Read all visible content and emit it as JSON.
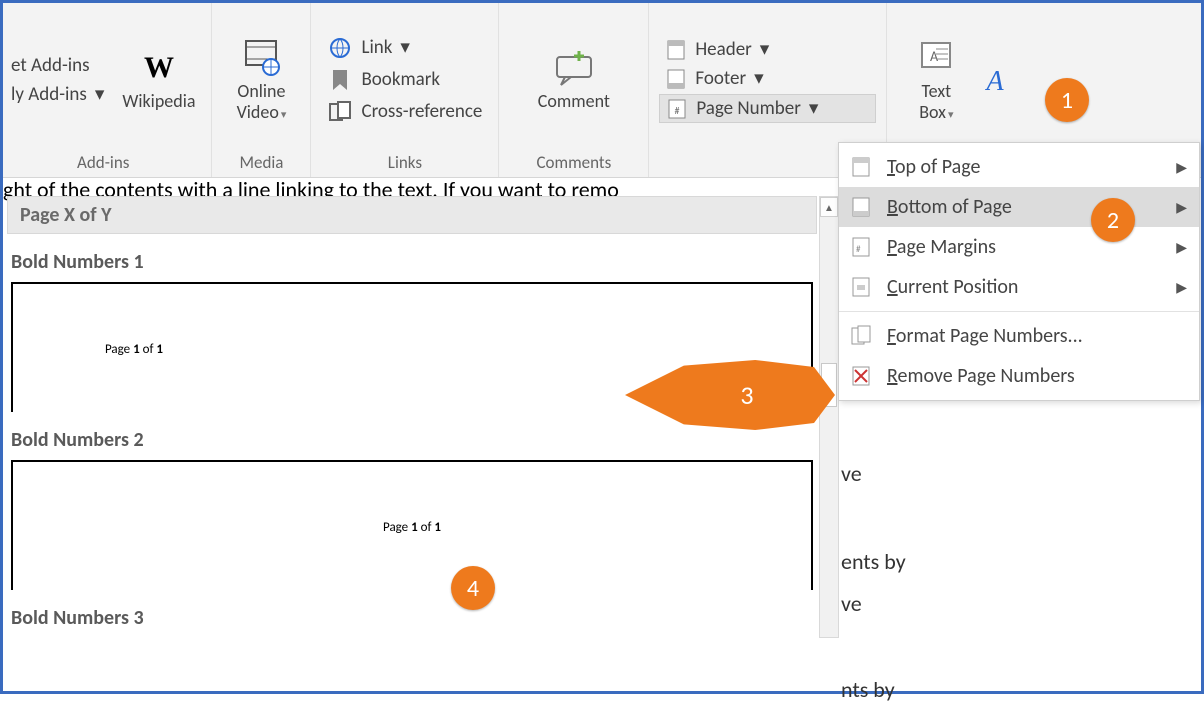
{
  "ribbon": {
    "addins": {
      "get": "et Add-ins",
      "my": "ly Add-ins",
      "wikipedia": "Wikipedia",
      "group": "Add-ins"
    },
    "media": {
      "online_video_l1": "Online",
      "online_video_l2": "Video",
      "group": "Media"
    },
    "links": {
      "link": "Link",
      "bookmark": "Bookmark",
      "crossref": "Cross-reference",
      "group": "Links"
    },
    "comments": {
      "comment": "Comment",
      "group": "Comments"
    },
    "headerfooter": {
      "header": "Header",
      "footer": "Footer",
      "page_number": "Page Number"
    },
    "text": {
      "textbox_l1": "Text",
      "textbox_l2": "Box"
    }
  },
  "cutline": "ght of the contents with a line linking to the text. If you want to remo",
  "gallery": {
    "header": "Page X of Y",
    "item1_title": "Bold Numbers 1",
    "item2_title": "Bold Numbers 2",
    "item3_title": "Bold Numbers 3",
    "sample_prefix": "Page ",
    "sample_bold1": "1",
    "sample_mid": " of ",
    "sample_bold2": "1"
  },
  "menu": {
    "top": "Top of Page",
    "bottom": "Bottom of Page",
    "margins": "Page Margins",
    "current": "Current Position",
    "format": "Format Page Numbers...",
    "remove": "Remove Page Numbers"
  },
  "behind": {
    "l1": "ve",
    "l2": "ents by",
    "l3": "ve",
    "l4": "nts by"
  },
  "badges": {
    "b1": "1",
    "b2": "2",
    "b3": "3",
    "b4": "4"
  }
}
